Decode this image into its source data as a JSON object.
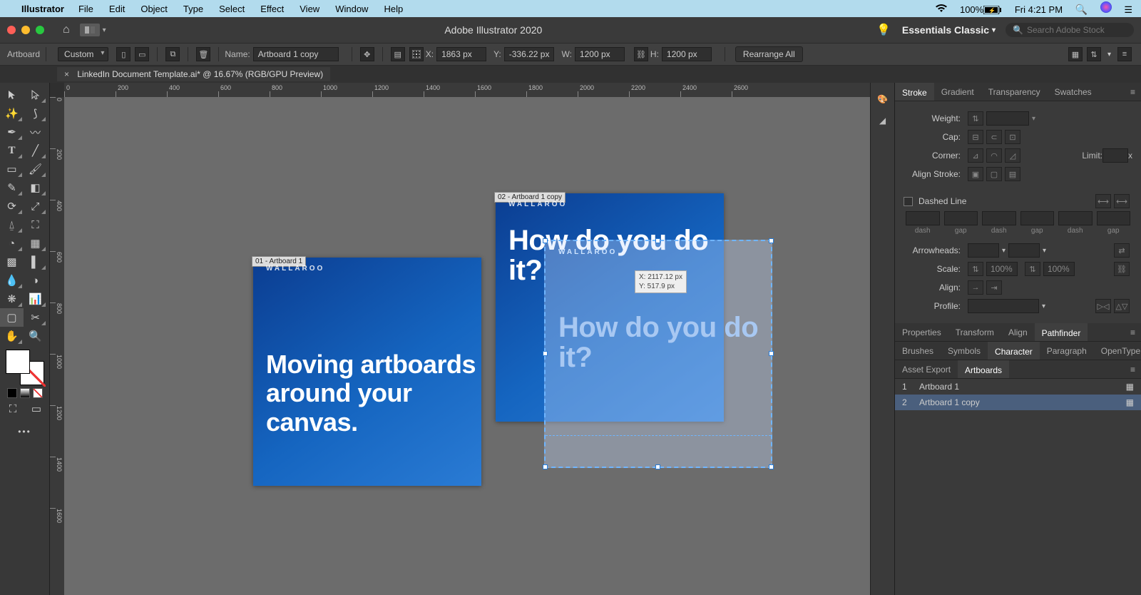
{
  "menubar": {
    "app": "Illustrator",
    "items": [
      "File",
      "Edit",
      "Object",
      "Type",
      "Select",
      "Effect",
      "View",
      "Window",
      "Help"
    ],
    "status": {
      "battery": "100%",
      "clock": "Fri 4:21 PM"
    }
  },
  "window": {
    "title": "Adobe Illustrator 2020",
    "workspace": "Essentials Classic",
    "search_placeholder": "Search Adobe Stock"
  },
  "control": {
    "tool_label": "Artboard",
    "preset": "Custom",
    "name_label": "Name:",
    "name_value": "Artboard 1 copy",
    "x_label": "X:",
    "x_value": "1863 px",
    "y_label": "Y:",
    "y_value": "-336.22 px",
    "w_label": "W:",
    "w_value": "1200 px",
    "h_label": "H:",
    "h_value": "1200 px",
    "rearrange": "Rearrange All"
  },
  "doc_tab": "LinkedIn Document Template.ai* @ 16.67% (RGB/GPU Preview)",
  "ruler_h": [
    "0",
    "200",
    "400",
    "600",
    "800",
    "1000",
    "1200",
    "1400",
    "1600",
    "1800",
    "2000",
    "2200",
    "2400",
    "2600"
  ],
  "ruler_v": [
    "0",
    "200",
    "400",
    "600",
    "800",
    "1000",
    "1200",
    "1400",
    "1600"
  ],
  "artboards": {
    "ab1": {
      "label": "01 - Artboard 1",
      "brand": "WALLAROO",
      "headline": "Moving artboards around your canvas."
    },
    "ab2": {
      "label": "02 - Artboard 1 copy",
      "brand": "WALLAROO",
      "headline": "How do you do it?"
    },
    "ghost": {
      "brand": "WALLAROO",
      "headline": "How do you do it?"
    }
  },
  "coord_tip": {
    "x": "X: 2117.12 px",
    "y": "Y: 517.9 px"
  },
  "panels": {
    "group1_tabs": [
      "Stroke",
      "Gradient",
      "Transparency",
      "Swatches"
    ],
    "stroke": {
      "weight": "Weight:",
      "cap": "Cap:",
      "corner": "Corner:",
      "limit": "Limit:",
      "limit_unit": "x",
      "align_stroke": "Align Stroke:",
      "dashed": "Dashed Line",
      "dash_labels": [
        "dash",
        "gap",
        "dash",
        "gap",
        "dash",
        "gap"
      ],
      "arrowheads": "Arrowheads:",
      "scale": "Scale:",
      "scale_val": "100%",
      "align": "Align:",
      "profile": "Profile:"
    },
    "group2_tabs": [
      "Properties",
      "Transform",
      "Align",
      "Pathfinder"
    ],
    "group3_tabs": [
      "Brushes",
      "Symbols",
      "Character",
      "Paragraph",
      "OpenType"
    ],
    "group4_tabs": [
      "Asset Export",
      "Artboards"
    ],
    "artboard_rows": [
      {
        "num": "1",
        "name": "Artboard 1"
      },
      {
        "num": "2",
        "name": "Artboard 1 copy"
      }
    ]
  }
}
